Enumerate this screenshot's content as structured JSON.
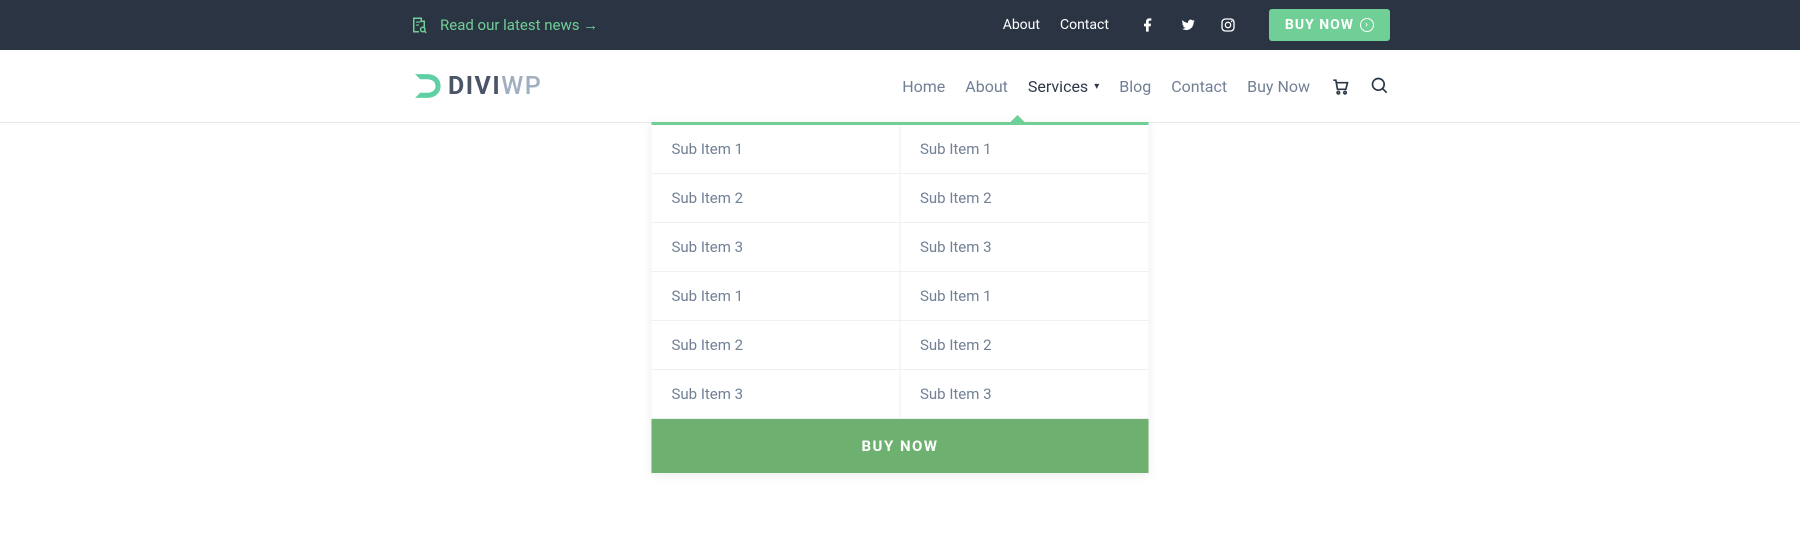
{
  "topbar": {
    "news_label": "Read our latest news →",
    "links": [
      "About",
      "Contact"
    ],
    "buy_now": "BUY NOW"
  },
  "logo": {
    "divi": "DIVI",
    "wp": "WP"
  },
  "nav": {
    "items": [
      "Home",
      "About",
      "Services",
      "Blog",
      "Contact",
      "Buy Now"
    ],
    "active_index": 2
  },
  "dropdown": {
    "col1": [
      "Sub Item 1",
      "Sub Item 2",
      "Sub Item 3",
      "Sub Item 1",
      "Sub Item 2",
      "Sub Item 3"
    ],
    "col2": [
      "Sub Item 1",
      "Sub Item 2",
      "Sub Item 3",
      "Sub Item 1",
      "Sub Item 2",
      "Sub Item 3"
    ],
    "cta": "BUY NOW"
  }
}
